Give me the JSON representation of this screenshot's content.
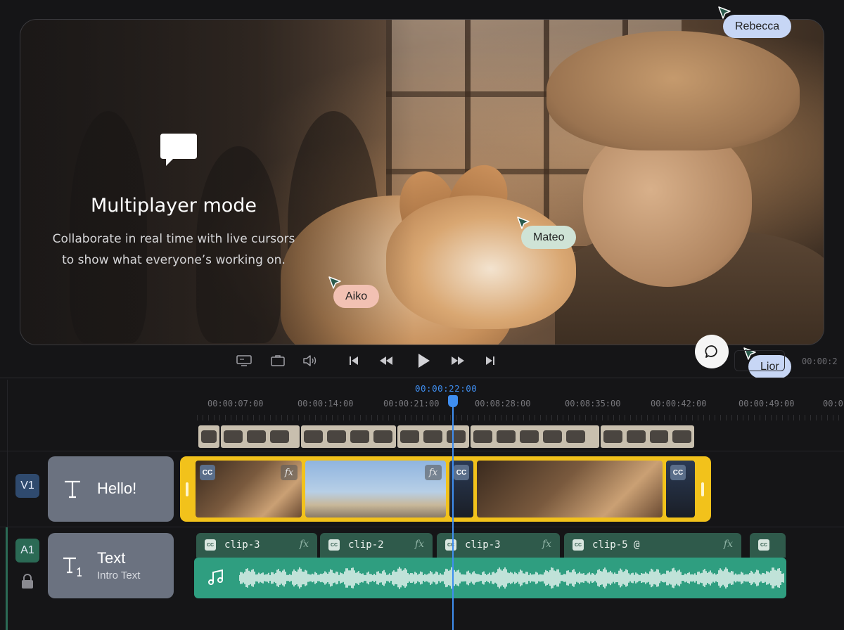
{
  "promo": {
    "title": "Multiplayer mode",
    "subtitle_line1": "Collaborate in real time with live cursors",
    "subtitle_line2": "to show what everyone’s working on."
  },
  "cursors": [
    {
      "name": "Rebecca",
      "color": "#c7d6f5"
    },
    {
      "name": "Mateo",
      "color": "#cfe3d6"
    },
    {
      "name": "Aiko",
      "color": "#f2c1b3"
    },
    {
      "name": "Lior",
      "color": "#c7d6f5"
    }
  ],
  "controls": {
    "icons": [
      "screen-icon",
      "briefcase-icon",
      "volume-icon",
      "skip-start-icon",
      "rewind-icon",
      "play-icon",
      "fast-forward-icon",
      "skip-end-icon"
    ],
    "right_timecode": "00:00:2"
  },
  "timeline": {
    "playhead_time": "00:00:22:00",
    "ticks": [
      "00:00:07:00",
      "00:00:14:00",
      "00:00:21:00",
      "00:08:28:00",
      "00:08:35:00",
      "00:00:42:00",
      "00:00:49:00",
      "00:0"
    ]
  },
  "tracks": {
    "video": {
      "badge": "V1",
      "card_title": "Hello!",
      "color": "#2f4a6e"
    },
    "audio": {
      "badge": "A1",
      "card_title": "Text",
      "card_subtitle": "Intro Text",
      "color": "#2b6a55"
    }
  },
  "video_clips": {
    "cc_label": "CC",
    "fx_label": "fx",
    "accent": "#f2c21b"
  },
  "audio_clips": [
    {
      "name": "clip-3",
      "fx": "fx"
    },
    {
      "name": "clip-2",
      "fx": "fx"
    },
    {
      "name": "clip-3",
      "fx": "fx"
    },
    {
      "name": "clip-5 @",
      "fx": "fx"
    },
    {
      "name": "",
      "fx": ""
    }
  ]
}
